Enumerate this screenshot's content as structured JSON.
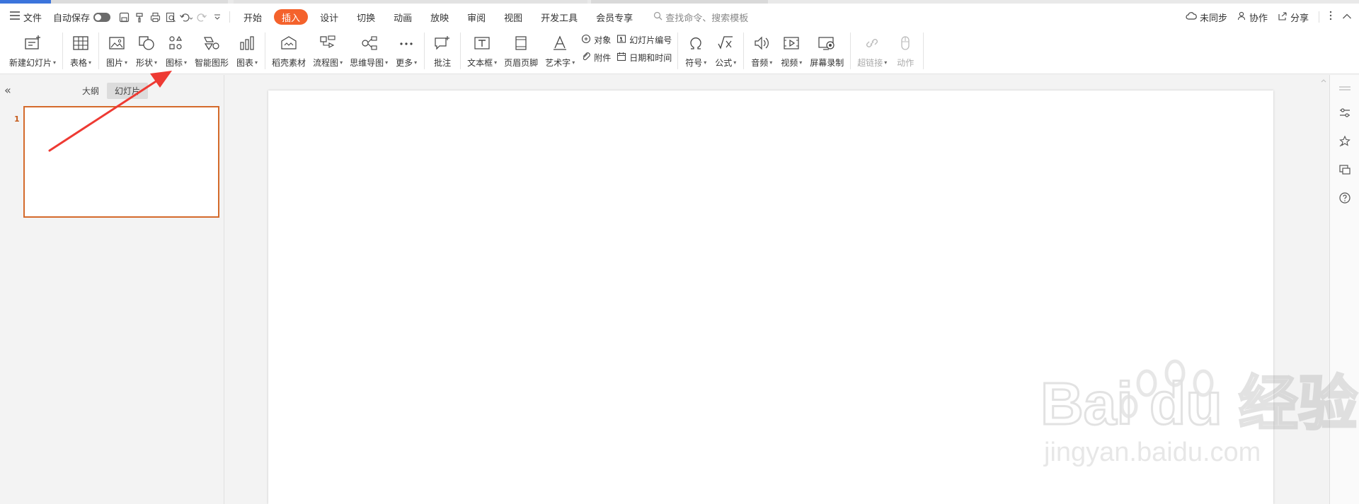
{
  "menubar": {
    "file_label": "文件",
    "autosave_label": "自动保存",
    "tabs": [
      "开始",
      "插入",
      "设计",
      "切换",
      "动画",
      "放映",
      "审阅",
      "视图",
      "开发工具",
      "会员专享"
    ],
    "search_placeholder": "查找命令、搜索模板",
    "sync_label": "未同步",
    "collab_label": "协作",
    "share_label": "分享"
  },
  "ribbon": {
    "new_slide": "新建幻灯片",
    "table": "表格",
    "picture": "图片",
    "shape": "形状",
    "icon": "图标",
    "smartart": "智能图形",
    "chart": "图表",
    "docer": "稻壳素材",
    "flowchart": "流程图",
    "mindmap": "思维导图",
    "more": "更多",
    "comment": "批注",
    "textbox": "文本框",
    "header_footer": "页眉页脚",
    "wordart": "艺术字",
    "object": "对象",
    "attachment": "附件",
    "slide_number": "幻灯片编号",
    "datetime": "日期和时间",
    "symbol": "符号",
    "formula": "公式",
    "audio": "音频",
    "video": "视频",
    "screen_record": "屏幕录制",
    "hyperlink": "超链接",
    "action": "动作"
  },
  "panel": {
    "collapse_symbol": "«",
    "outline_tab": "大纲",
    "slides_tab": "幻灯片",
    "slide_number": "1"
  },
  "watermark": {
    "brand": "Bai  du 经验",
    "url": "jingyan.baidu.com"
  },
  "colors": {
    "accent": "#f4622c",
    "selection": "#d46a2b",
    "arrow": "#ee3a33"
  }
}
